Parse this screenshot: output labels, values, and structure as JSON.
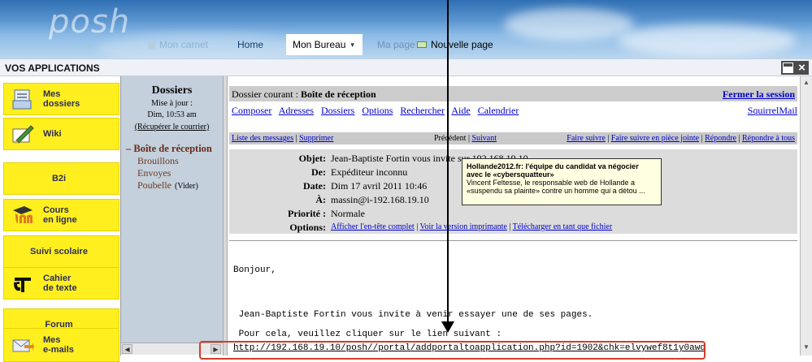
{
  "banner": {
    "logo": "posh",
    "nav": {
      "carnet": "Mon carnet",
      "home": "Home",
      "bureau": "Mon Bureau",
      "bureau_chevron": "▾",
      "ma_page": "Ma page",
      "nouvelle_page": "Nouvelle page"
    }
  },
  "apps_bar": {
    "title": "VOS APPLICATIONS"
  },
  "apps": [
    {
      "label": "Mes\ndossiers",
      "icon": "folder-icon"
    },
    {
      "label": "Wiki",
      "icon": "pencil-icon"
    },
    {
      "label": "B2i",
      "icon": ""
    },
    {
      "label": "Cours\nen ligne",
      "icon": "moodle-icon"
    },
    {
      "label": "Suivi scolaire",
      "icon": ""
    },
    {
      "label": "Cahier\nde texte",
      "icon": "cdt-icon"
    },
    {
      "label": "Forum",
      "icon": ""
    },
    {
      "label": "Mes\ne-mails",
      "icon": "mail-icon"
    }
  ],
  "folders": {
    "title": "Dossiers",
    "updated_label": "Mise à jour :",
    "updated_time": "Dim, 10:53 am",
    "fetch_link": "(Récupérer le courrier)",
    "items": [
      {
        "label": "Boîte de réception",
        "current": true
      },
      {
        "label": "Brouillons"
      },
      {
        "label": "Envoyes"
      },
      {
        "label": "Poubelle",
        "extra": "(Vider)"
      }
    ]
  },
  "mail": {
    "current_folder_label": "Dossier courant :",
    "current_folder": "Boîte de réception",
    "logout": "Fermer la session",
    "menu": [
      "Composer",
      "Adresses",
      "Dossiers",
      "Options",
      "Rechercher",
      "Aide",
      "Calendrier"
    ],
    "brand": "SquirrelMail",
    "actions_left": [
      "Liste des messages",
      "Supprimer"
    ],
    "prev": "Précédent",
    "next": "Suivant",
    "actions_right": [
      "Faire suivre",
      "Faire suivre en pièce jointe",
      "Répondre",
      "Répondre à tous"
    ],
    "headers": {
      "objet_k": "Objet:",
      "objet_v": "Jean-Baptiste Fortin vous invite sur 192.168.19.10",
      "de_k": "De:",
      "de_v": "Expéditeur inconnu",
      "date_k": "Date:",
      "date_v": "Dim 17 avril 2011 10:46",
      "a_k": "À:",
      "a_v": "massin@i-192.168.19.10",
      "prio_k": "Priorité :",
      "prio_v": "Normale",
      "opts_k": "Options:",
      "opts": [
        "Afficher l'en-tête complet",
        "Voir la version imprimante",
        "Télécharger en tant que fichier"
      ]
    },
    "body": {
      "greeting": "Bonjour,",
      "line1": " Jean-Baptiste Fortin vous invite à venir essayer une de ses pages.",
      "line2": " Pour cela, veuillez cliquer sur le lien suivant :",
      "link": "http://192.168.19.10/posh//portal/addportaltoapplication.php?id=1902&chk=elvywef8t1y0awd"
    }
  },
  "tooltip": {
    "title": "Hollande2012.fr: l'équipe du candidat va négocier avec le «cybersquatteur»",
    "text": "Vincent Feltesse, le responsable web de Hollande a «suspendu sa plainte» contre un homme qui a détou ..."
  },
  "colors": {
    "app_yellow": "#ffef1f",
    "folder_bg": "#c4d0dc",
    "link_blue": "#0000cc",
    "annotation_red": "#d23c2c"
  }
}
